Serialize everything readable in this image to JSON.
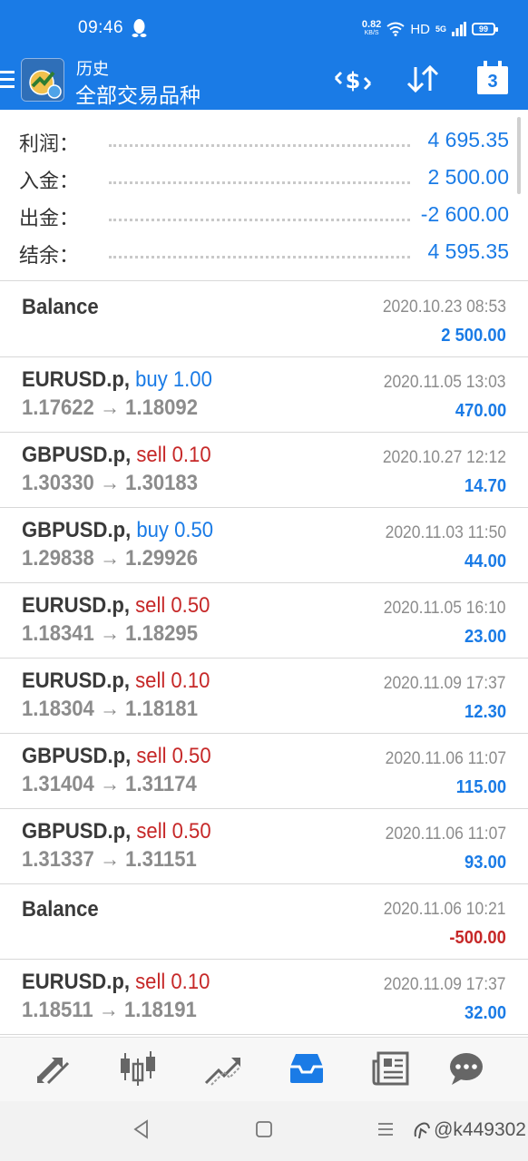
{
  "status_bar": {
    "time": "09:46",
    "speed_value": "0.82",
    "speed_unit": "KB/S",
    "hd": "HD",
    "network": "5G",
    "battery": "99"
  },
  "app_bar": {
    "subtitle": "历史",
    "title": "全部交易品种",
    "calendar_day": "3"
  },
  "summary": [
    {
      "label": "利润：",
      "value": "4 695.35"
    },
    {
      "label": "入金：",
      "value": "2 500.00"
    },
    {
      "label": "出金：",
      "value": "-2 600.00"
    },
    {
      "label": "结余：",
      "value": "4 595.35"
    }
  ],
  "history": [
    {
      "symbol": "Balance",
      "action": "",
      "side": "",
      "prices": "",
      "time": "2020.10.23 08:53",
      "profit": "2 500.00",
      "profit_sign": "pos"
    },
    {
      "symbol": "EURUSD.p,",
      "action": "buy 1.00",
      "side": "buy",
      "prices": "1.17622 → 1.18092",
      "time": "2020.11.05 13:03",
      "profit": "470.00",
      "profit_sign": "pos"
    },
    {
      "symbol": "GBPUSD.p,",
      "action": "sell 0.10",
      "side": "sell",
      "prices": "1.30330 → 1.30183",
      "time": "2020.10.27 12:12",
      "profit": "14.70",
      "profit_sign": "pos"
    },
    {
      "symbol": "GBPUSD.p,",
      "action": "buy 0.50",
      "side": "buy",
      "prices": "1.29838 → 1.29926",
      "time": "2020.11.03 11:50",
      "profit": "44.00",
      "profit_sign": "pos"
    },
    {
      "symbol": "EURUSD.p,",
      "action": "sell 0.50",
      "side": "sell",
      "prices": "1.18341 → 1.18295",
      "time": "2020.11.05 16:10",
      "profit": "23.00",
      "profit_sign": "pos"
    },
    {
      "symbol": "EURUSD.p,",
      "action": "sell 0.10",
      "side": "sell",
      "prices": "1.18304 → 1.18181",
      "time": "2020.11.09 17:37",
      "profit": "12.30",
      "profit_sign": "pos"
    },
    {
      "symbol": "GBPUSD.p,",
      "action": "sell 0.50",
      "side": "sell",
      "prices": "1.31404 → 1.31174",
      "time": "2020.11.06 11:07",
      "profit": "115.00",
      "profit_sign": "pos"
    },
    {
      "symbol": "GBPUSD.p,",
      "action": "sell 0.50",
      "side": "sell",
      "prices": "1.31337 → 1.31151",
      "time": "2020.11.06 11:07",
      "profit": "93.00",
      "profit_sign": "pos"
    },
    {
      "symbol": "Balance",
      "action": "",
      "side": "",
      "prices": "",
      "time": "2020.11.06 10:21",
      "profit": "-500.00",
      "profit_sign": "neg"
    },
    {
      "symbol": "EURUSD.p,",
      "action": "sell 0.10",
      "side": "sell",
      "prices": "1.18511 → 1.18191",
      "time": "2020.11.09 17:37",
      "profit": "32.00",
      "profit_sign": "pos"
    }
  ],
  "bottom_nav": [
    {
      "name": "nav-quotes",
      "icon": "quotes-arrows-icon",
      "active": false
    },
    {
      "name": "nav-chart",
      "icon": "candlestick-icon",
      "active": false
    },
    {
      "name": "nav-trade",
      "icon": "trade-line-icon",
      "active": false
    },
    {
      "name": "nav-history",
      "icon": "inbox-tray-icon",
      "active": true
    },
    {
      "name": "nav-news",
      "icon": "newspaper-icon",
      "active": false
    },
    {
      "name": "nav-chat",
      "icon": "chat-bubble-icon",
      "active": false
    }
  ],
  "watermark": "@k449302",
  "colors": {
    "brand_blue": "#1a7be6",
    "sell_red": "#c62828",
    "muted_gray": "#8c8c8c"
  }
}
